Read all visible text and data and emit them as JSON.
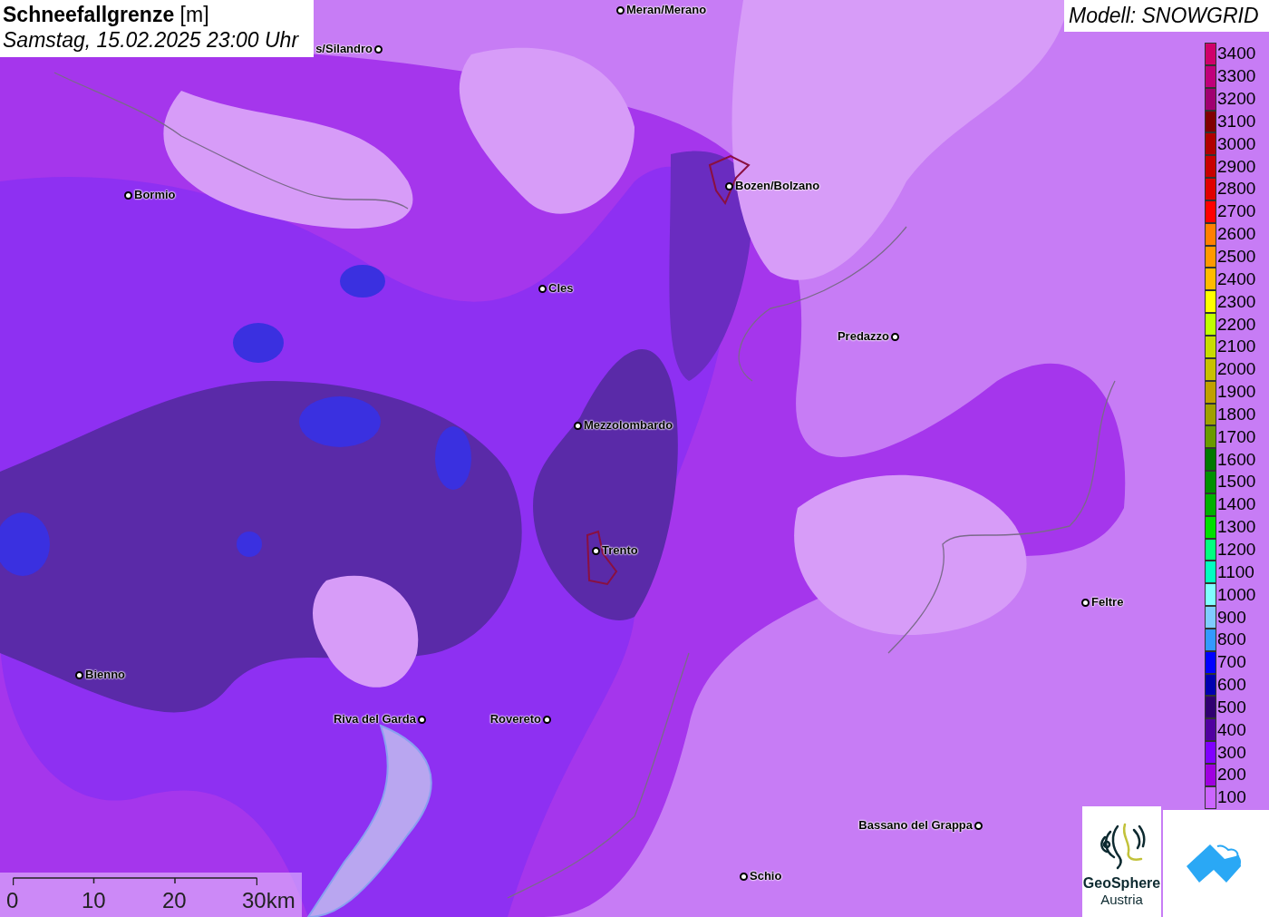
{
  "header": {
    "title": "**Schneefallgrenze** [m]",
    "datetime": "Samstag, 15.02.2025 23:00 Uhr"
  },
  "model": "Modell: SNOWGRID",
  "cities": [
    {
      "name": "Meran/Merano"
    },
    {
      "name": "s/Silandro"
    },
    {
      "name": "Bormio"
    },
    {
      "name": "Bozen/Bolzano"
    },
    {
      "name": "Cles"
    },
    {
      "name": "Predazzo"
    },
    {
      "name": "Mezzolombardo"
    },
    {
      "name": "Trento"
    },
    {
      "name": "Feltre"
    },
    {
      "name": "Bienno"
    },
    {
      "name": "Riva del Garda"
    },
    {
      "name": "Rovereto"
    },
    {
      "name": "Bassano del Grappa"
    },
    {
      "name": "Schio"
    }
  ],
  "legend": [
    {
      "label": "3400",
      "color": "#d0006a"
    },
    {
      "label": "3300",
      "color": "#c0007a"
    },
    {
      "label": "3200",
      "color": "#a00070"
    },
    {
      "label": "3100",
      "color": "#800000"
    },
    {
      "label": "3000",
      "color": "#b00000"
    },
    {
      "label": "2900",
      "color": "#c80000"
    },
    {
      "label": "2800",
      "color": "#e00000"
    },
    {
      "label": "2700",
      "color": "#ff0000"
    },
    {
      "label": "2600",
      "color": "#ff8000"
    },
    {
      "label": "2500",
      "color": "#ff9900"
    },
    {
      "label": "2400",
      "color": "#ffbb00"
    },
    {
      "label": "2300",
      "color": "#ffff00"
    },
    {
      "label": "2200",
      "color": "#c0ff00"
    },
    {
      "label": "2100",
      "color": "#c8dc00"
    },
    {
      "label": "2000",
      "color": "#c8c000"
    },
    {
      "label": "1900",
      "color": "#c0a000"
    },
    {
      "label": "1800",
      "color": "#a0a000"
    },
    {
      "label": "1700",
      "color": "#6a9a00"
    },
    {
      "label": "1600",
      "color": "#007800"
    },
    {
      "label": "1500",
      "color": "#009000"
    },
    {
      "label": "1400",
      "color": "#00b000"
    },
    {
      "label": "1300",
      "color": "#00e000"
    },
    {
      "label": "1200",
      "color": "#00ff80"
    },
    {
      "label": "1100",
      "color": "#00ffc0"
    },
    {
      "label": "1000",
      "color": "#80ffff"
    },
    {
      "label": "900",
      "color": "#80ccff"
    },
    {
      "label": "800",
      "color": "#3399ff"
    },
    {
      "label": "700",
      "color": "#0000ff"
    },
    {
      "label": "600",
      "color": "#0000b0"
    },
    {
      "label": "500",
      "color": "#300070"
    },
    {
      "label": "400",
      "color": "#5000a0"
    },
    {
      "label": "300",
      "color": "#8000ff"
    },
    {
      "label": "200",
      "color": "#a000e0"
    },
    {
      "label": "100",
      "color": "#cc66ff"
    }
  ],
  "scale": [
    "0",
    "10",
    "20",
    "30km"
  ],
  "logo": {
    "name": "GeoSphere",
    "sub": "Austria"
  }
}
